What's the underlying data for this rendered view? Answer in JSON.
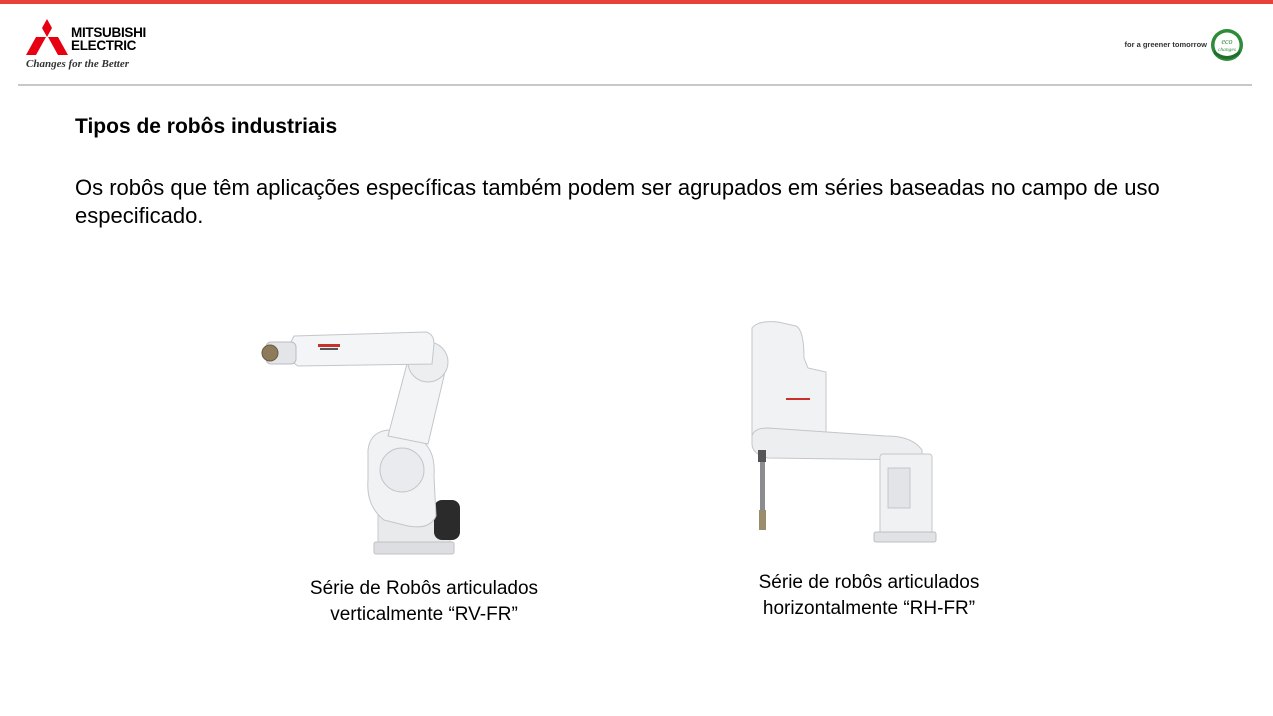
{
  "header": {
    "brand_line1": "MITSUBISHI",
    "brand_line2": "ELECTRIC",
    "brand_tagline": "Changes for the Better",
    "eco_tagline": "for a greener tomorrow",
    "eco_badge_text": "eco changes",
    "brand_color": "#e60012",
    "accent_bar_color": "#e8413a"
  },
  "slide": {
    "title": "Tipos de robôs industriais",
    "body": "Os robôs que têm aplicações específicas também podem ser agrupados em séries baseadas no campo de uso especificado."
  },
  "figures": [
    {
      "caption_line1": "Série de Robôs articulados",
      "caption_line2": "verticalmente “RV-FR”",
      "image": "vertical-articulated-robot"
    },
    {
      "caption_line1": "Série de robôs articulados",
      "caption_line2": "horizontalmente “RH-FR”",
      "image": "horizontal-scara-robot"
    }
  ]
}
